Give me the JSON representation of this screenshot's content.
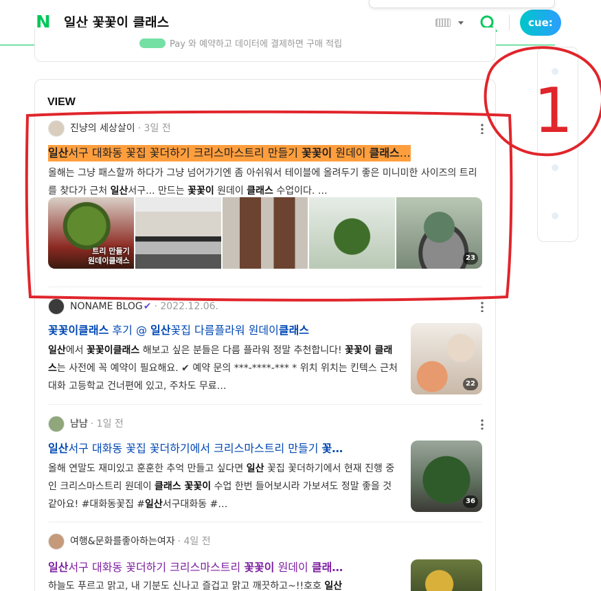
{
  "header": {
    "logo": "N",
    "query": "일산 꽃꽃이 클래스",
    "cue_label": "cue:",
    "icons": [
      "keyboard-icon",
      "chevron-down-icon",
      "search-icon"
    ]
  },
  "prev_card": {
    "text": "Pay 와 예약하고 데이터에 결제하면 구매 적립"
  },
  "view": {
    "section_title": "VIEW",
    "posts": [
      {
        "author": "진냥의 세상살이",
        "date": "3일 전",
        "title_parts": [
          {
            "t": "일산",
            "b": true
          },
          {
            "t": "서구 대화동 꽃집 꽃더하기 크리스마스트리 만들기 ",
            "b": false
          },
          {
            "t": "꽃꽃이",
            "b": true
          },
          {
            "t": " 원데이 ",
            "b": false
          },
          {
            "t": "클래스",
            "b": true
          },
          {
            "t": "…",
            "b": false
          }
        ],
        "desc_parts": [
          {
            "t": "올해는 그냥 패스할까 하다가 그냥 넘어가기엔 좀 아쉬워서 테이블에 올려두기 좋은 미니미한 사이즈의 트리를 찾다가 근처 ",
            "b": false
          },
          {
            "t": "일산",
            "b": true
          },
          {
            "t": "서구... 만드는 ",
            "b": false
          },
          {
            "t": "꽃꽃이",
            "b": true
          },
          {
            "t": " 원데이 ",
            "b": false
          },
          {
            "t": "클래스",
            "b": true
          },
          {
            "t": " 수업이다. …",
            "b": false
          }
        ],
        "thumb_caption": "트리 만들기\n원데이클래스",
        "image_count": "23"
      },
      {
        "author": "NONAME BLOG",
        "verified": "✔",
        "date": "2022.12.06.",
        "title_parts": [
          {
            "t": "꽃꽃이클래스",
            "b": true
          },
          {
            "t": " 후기 @ ",
            "b": false
          },
          {
            "t": "일산",
            "b": true
          },
          {
            "t": "꽃집 다름플라워 원데이",
            "b": false
          },
          {
            "t": "클래스",
            "b": true
          }
        ],
        "desc_parts": [
          {
            "t": "일산",
            "b": true
          },
          {
            "t": "에서 ",
            "b": false
          },
          {
            "t": "꽃꽃이클래스",
            "b": true
          },
          {
            "t": " 해보고 싶은 분들은 다름 플라워 정말 추천합니다! ",
            "b": false
          },
          {
            "t": "꽃꽃이 클래스",
            "b": true
          },
          {
            "t": "는 사전에 꼭 예약이 필요해요. ✔ 예약 문의 ***-****-*** * 위치 위치는 킨텍스 근처 대화 고등학교 건너편에 있고, 주차도 무료…",
            "b": false
          }
        ],
        "image_count": "22"
      },
      {
        "author": "냠냠",
        "date": "1일 전",
        "title_parts": [
          {
            "t": "일산",
            "b": true
          },
          {
            "t": "서구 대화동 꽃집 꽃더하기에서 크리스마스트리 만들기 ",
            "b": false
          },
          {
            "t": "꽃…",
            "b": true
          }
        ],
        "desc_parts": [
          {
            "t": "올해 연말도 재미있고 훈훈한 추억 만들고 싶다면 ",
            "b": false
          },
          {
            "t": "일산",
            "b": true
          },
          {
            "t": " 꽃집 꽃더하기에서 현재 진행 중인 크리스마스트리 원데이 ",
            "b": false
          },
          {
            "t": "클래스 꽃꽃이",
            "b": true
          },
          {
            "t": " 수업 한번 들어보시라 가보셔도 정말 좋을 것 같아요! #대화동꽃집 #",
            "b": false
          },
          {
            "t": "일산",
            "b": true
          },
          {
            "t": "서구대화동 #…",
            "b": false
          }
        ],
        "image_count": "36"
      },
      {
        "author": "여행&문화를좋아하는여자",
        "date": "4일 전",
        "title_parts": [
          {
            "t": "일산",
            "b": true
          },
          {
            "t": "서구 대화동 꽃더하기 크리스마스트리 ",
            "b": false
          },
          {
            "t": "꽃꽃이",
            "b": true
          },
          {
            "t": " 원데이 ",
            "b": false
          },
          {
            "t": "클래…",
            "b": true
          }
        ],
        "desc_parts": [
          {
            "t": "하늘도 푸르고 맑고, 내 기분도 신나고 즐겁고 맑고 깨끗하고~!!호호 ",
            "b": false
          },
          {
            "t": "일산",
            "b": true
          }
        ],
        "image_count": ""
      }
    ]
  },
  "colors": {
    "naver_green": "#03c75a",
    "link_blue": "#0047b3",
    "visited_purple": "#7c1fa0",
    "highlight": "#ff9e3d",
    "annotation_red": "#e0252b"
  },
  "annotation": {
    "label": "1"
  }
}
